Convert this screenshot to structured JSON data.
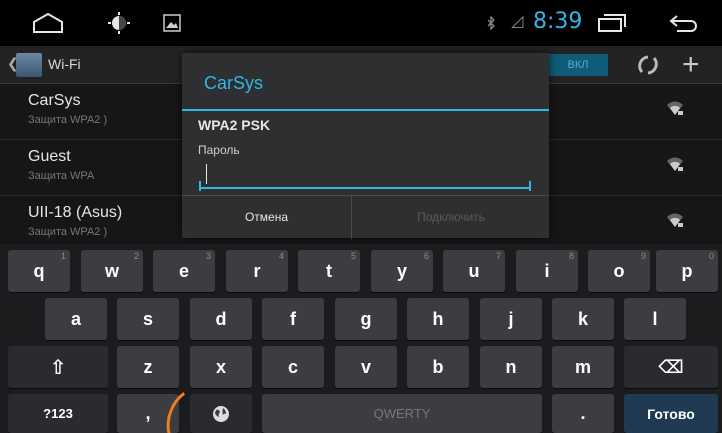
{
  "status_bar": {
    "time": "8:39",
    "icons": [
      "home-icon",
      "brightness-icon",
      "gallery-icon",
      "bluetooth-icon",
      "signal-icon",
      "recent-apps-icon",
      "back-icon"
    ]
  },
  "action_bar": {
    "title": "Wi-Fi",
    "toggle_label": "ВКЛ",
    "add_label": "+"
  },
  "wifi_networks": [
    {
      "name": "CarSys",
      "security": "Защита WPA2 )"
    },
    {
      "name": "Guest",
      "security": "Защита WPA"
    },
    {
      "name": "UII-18 (Asus)",
      "security": "Защита WPA2 )"
    }
  ],
  "dialog": {
    "title": "CarSys",
    "security": "WPA2 PSK",
    "password_label": "Пароль",
    "password_value": "",
    "cancel_label": "Отмена",
    "connect_label": "Подключить"
  },
  "keyboard": {
    "row1": [
      {
        "k": "q",
        "h": "1"
      },
      {
        "k": "w",
        "h": "2"
      },
      {
        "k": "e",
        "h": "3"
      },
      {
        "k": "r",
        "h": "4"
      },
      {
        "k": "t",
        "h": "5"
      },
      {
        "k": "y",
        "h": "6"
      },
      {
        "k": "u",
        "h": "7"
      },
      {
        "k": "i",
        "h": "8"
      },
      {
        "k": "o",
        "h": "9"
      },
      {
        "k": "p",
        "h": "0"
      }
    ],
    "row2": [
      "a",
      "s",
      "d",
      "f",
      "g",
      "h",
      "j",
      "k",
      "l"
    ],
    "row3": [
      "z",
      "x",
      "c",
      "v",
      "b",
      "n",
      "m"
    ],
    "shift_label": "⇧",
    "backspace_label": "⌫",
    "symbols_label": "?123",
    "comma_label": ",",
    "space_label": "QWERTY",
    "period_label": ".",
    "done_label": "Готово"
  },
  "colors": {
    "accent": "#33b5e5",
    "annotation": "#f07d1e"
  }
}
